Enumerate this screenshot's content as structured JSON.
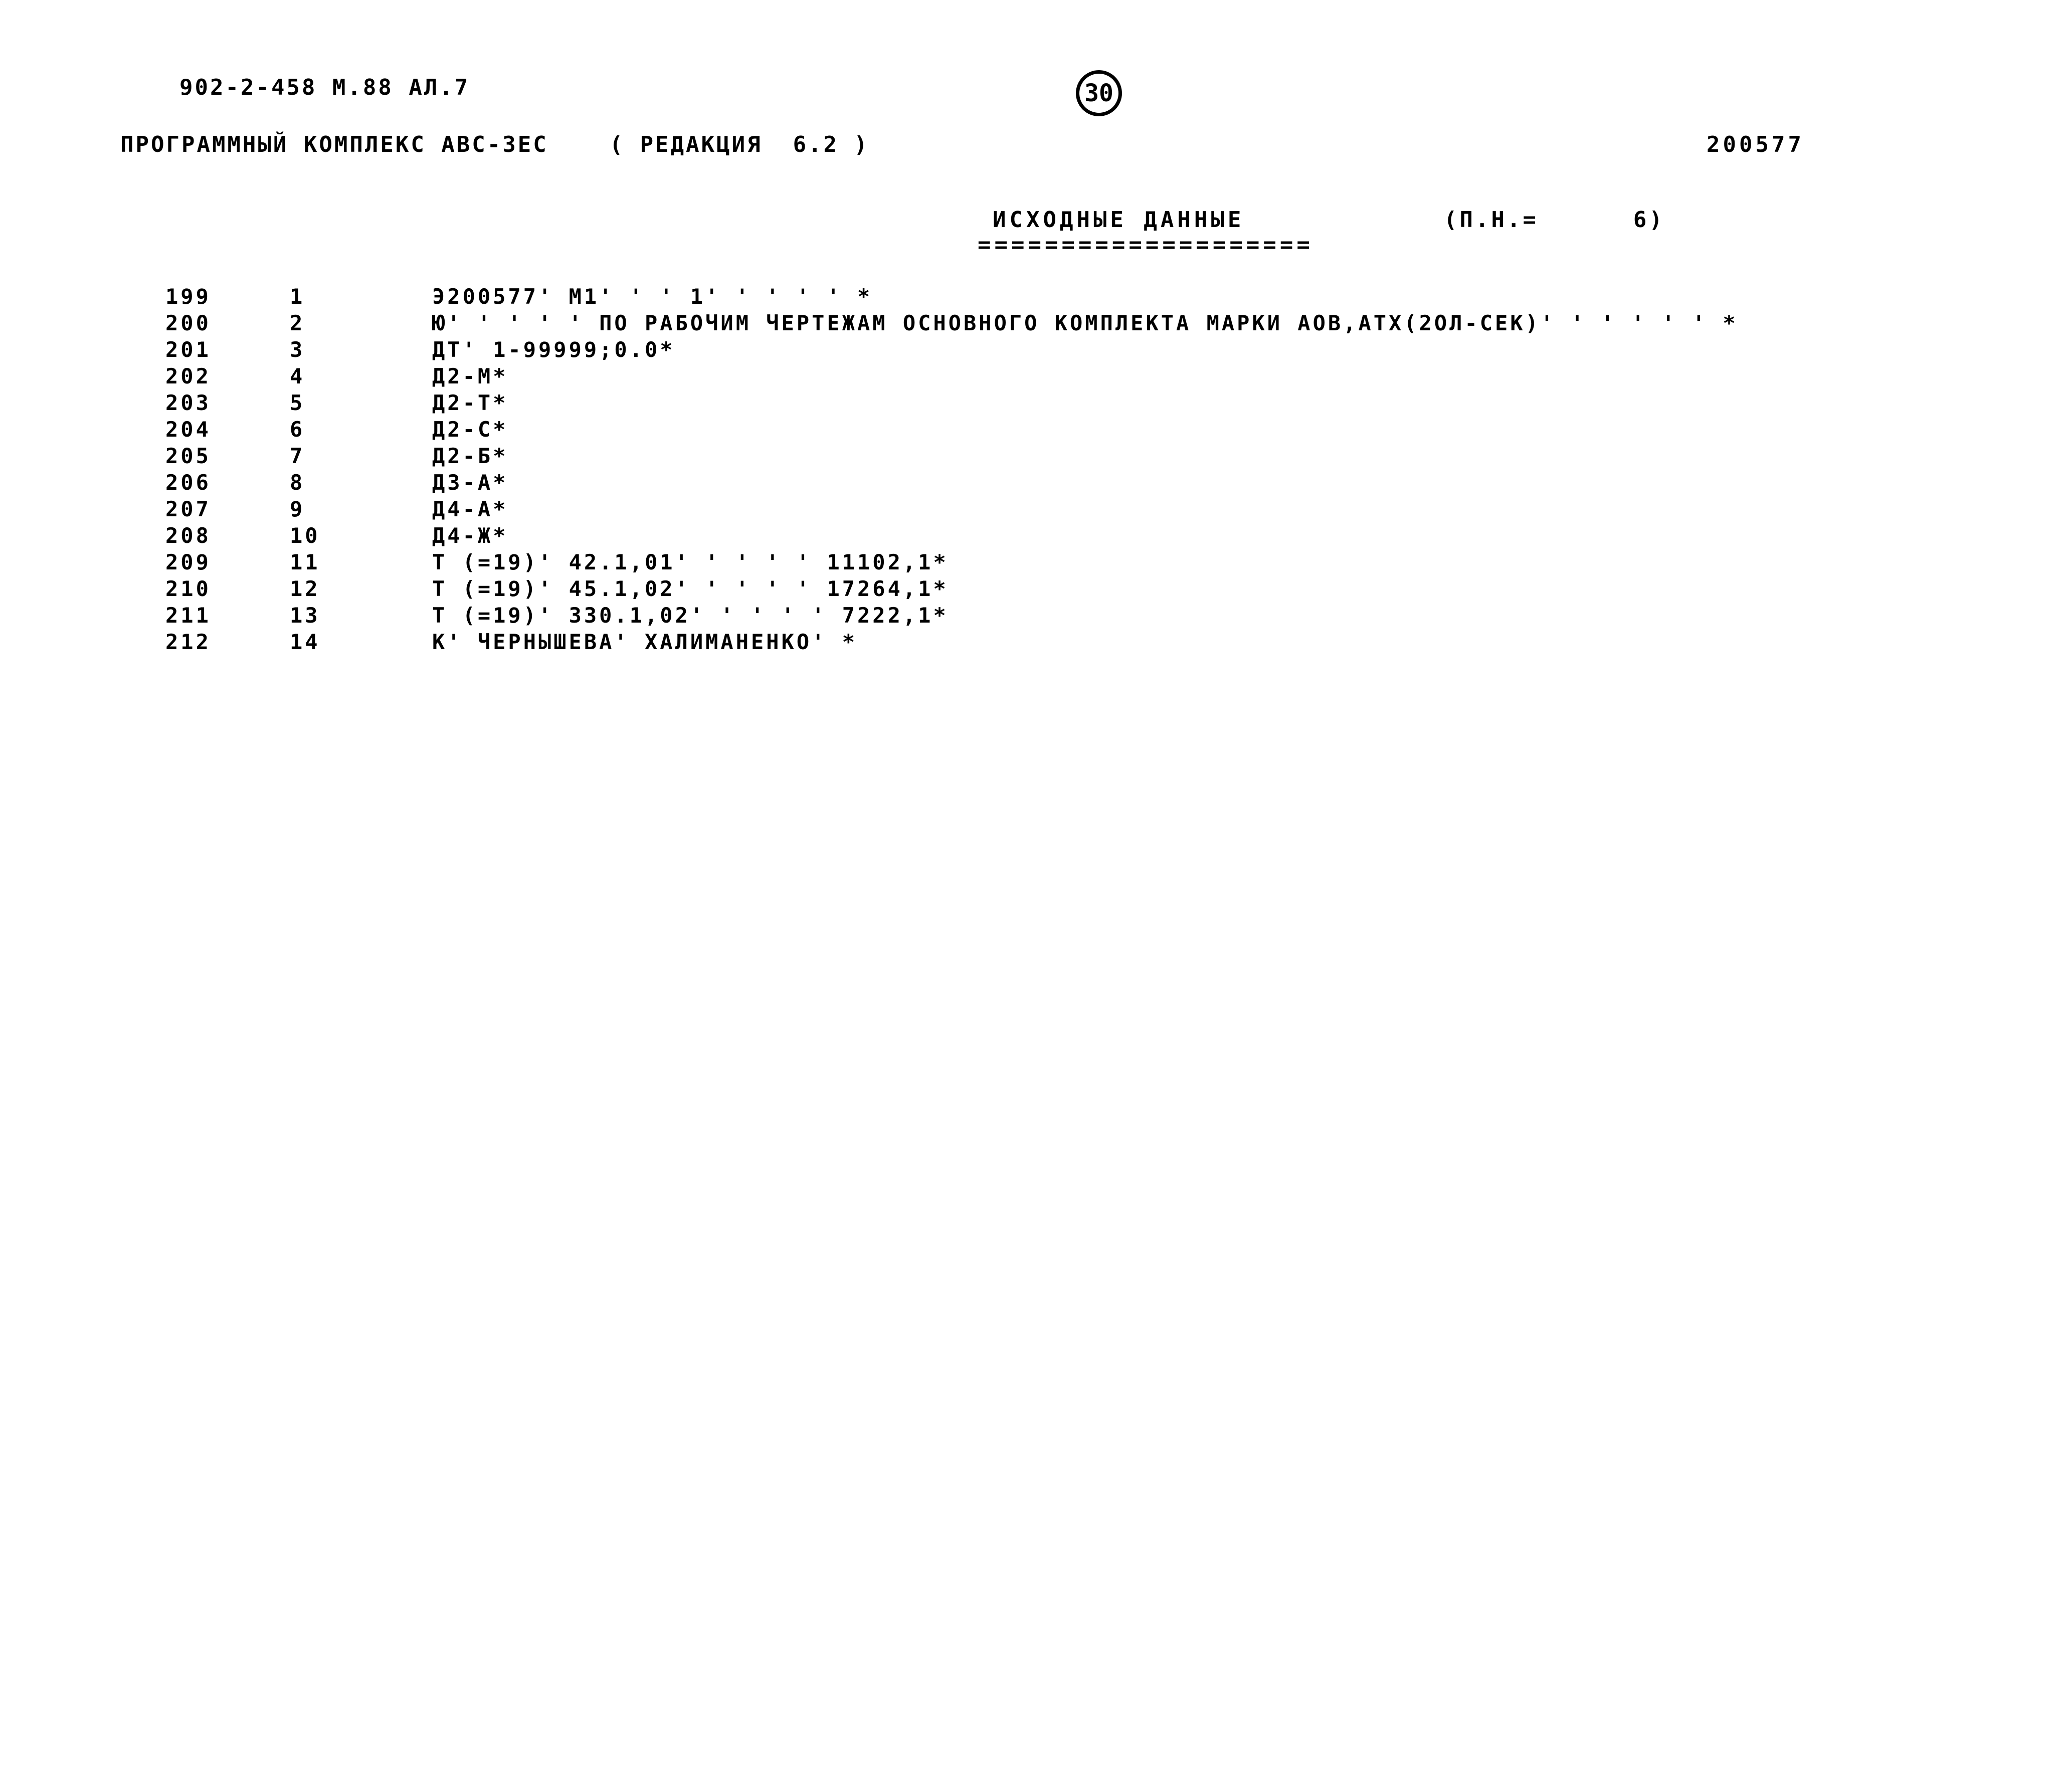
{
  "header": {
    "doc_code": "902-2-458 М.88 АЛ.7",
    "complex_line": "ПРОГРАММНЫЙ КОМПЛЕКС АВС-3ЕС    ( РЕДАКЦИЯ  6.2 )",
    "right_code": "200577",
    "page_number": "30"
  },
  "section": {
    "title": "ИСХОДНЫЕ ДАННЫЕ",
    "rule": "====================",
    "pn_label": "(П.Н.=      6)"
  },
  "listing": {
    "rows": [
      {
        "seq": "199",
        "num": "1",
        "text": "Э200577' М1' ' ' 1' ' ' ' ' *"
      },
      {
        "seq": "200",
        "num": "2",
        "text": "Ю' ' ' ' ' ПО РАБОЧИМ ЧЕРТЕЖАМ ОСНОВНОГО КОМПЛЕКТА МАРКИ АОВ,АТХ(2ОЛ-СЕК)' ' ' ' ' ' *"
      },
      {
        "seq": "201",
        "num": "3",
        "text": "ДТ' 1-99999;0.0*"
      },
      {
        "seq": "202",
        "num": "4",
        "text": "Д2-М*"
      },
      {
        "seq": "203",
        "num": "5",
        "text": "Д2-Т*"
      },
      {
        "seq": "204",
        "num": "6",
        "text": "Д2-С*"
      },
      {
        "seq": "205",
        "num": "7",
        "text": "Д2-Б*"
      },
      {
        "seq": "206",
        "num": "8",
        "text": "Д3-А*"
      },
      {
        "seq": "207",
        "num": "9",
        "text": "Д4-А*"
      },
      {
        "seq": "208",
        "num": "10",
        "text": "Д4-Ж*"
      },
      {
        "seq": "209",
        "num": "11",
        "text": "Т (=19)' 42.1,01' ' ' ' ' 11102,1*"
      },
      {
        "seq": "210",
        "num": "12",
        "text": "Т (=19)' 45.1,02' ' ' ' ' 17264,1*"
      },
      {
        "seq": "211",
        "num": "13",
        "text": "Т (=19)' 330.1,02' ' ' ' ' 7222,1*"
      },
      {
        "seq": "212",
        "num": "14",
        "text": "К' ЧЕРНЫШЕВА' ХАЛИМАНЕНКО' *"
      }
    ]
  }
}
